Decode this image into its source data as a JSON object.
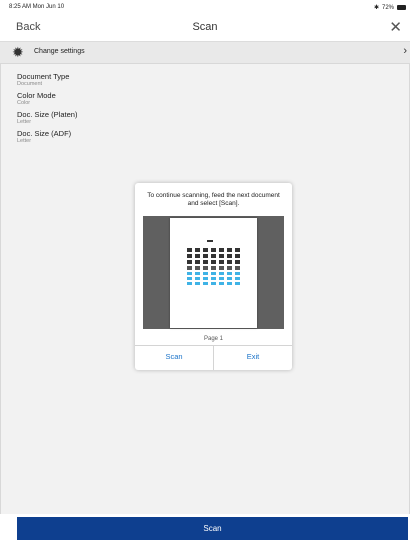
{
  "status_bar": {
    "time_date": "8:25 AM   Mon Jun 10",
    "battery_text": "72%"
  },
  "nav": {
    "back_label": "Back",
    "title": "Scan",
    "close_glyph": "✕"
  },
  "settings_row": {
    "label": "Change settings",
    "icon": "gear-icon",
    "chevron_glyph": "›"
  },
  "settings": [
    {
      "title": "Document Type",
      "value": "Document"
    },
    {
      "title": "Color Mode",
      "value": "Color"
    },
    {
      "title": "Doc. Size (Platen)",
      "value": "Letter"
    },
    {
      "title": "Doc. Size (ADF)",
      "value": "Letter"
    }
  ],
  "dialog": {
    "message": "To continue scanning, feed the next document and select [Scan].",
    "page_label": "Page 1",
    "buttons": {
      "scan": "Scan",
      "exit": "Exit"
    }
  },
  "bottom": {
    "scan_button_label": "Scan"
  },
  "colors": {
    "accent_blue": "#1a73c9",
    "primary_button": "#0e3f8f",
    "bar_blue": "#3fb3e6",
    "bar_dark": "#333333"
  }
}
